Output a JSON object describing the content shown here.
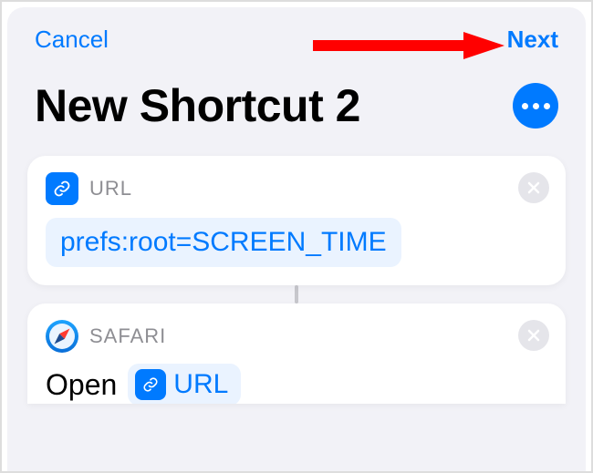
{
  "nav": {
    "cancel": "Cancel",
    "next": "Next"
  },
  "title": "New Shortcut 2",
  "actions": [
    {
      "app_label": "URL",
      "value": "prefs:root=SCREEN_TIME"
    },
    {
      "app_label": "SAFARI",
      "open_label": "Open",
      "chip_text": "URL"
    }
  ]
}
